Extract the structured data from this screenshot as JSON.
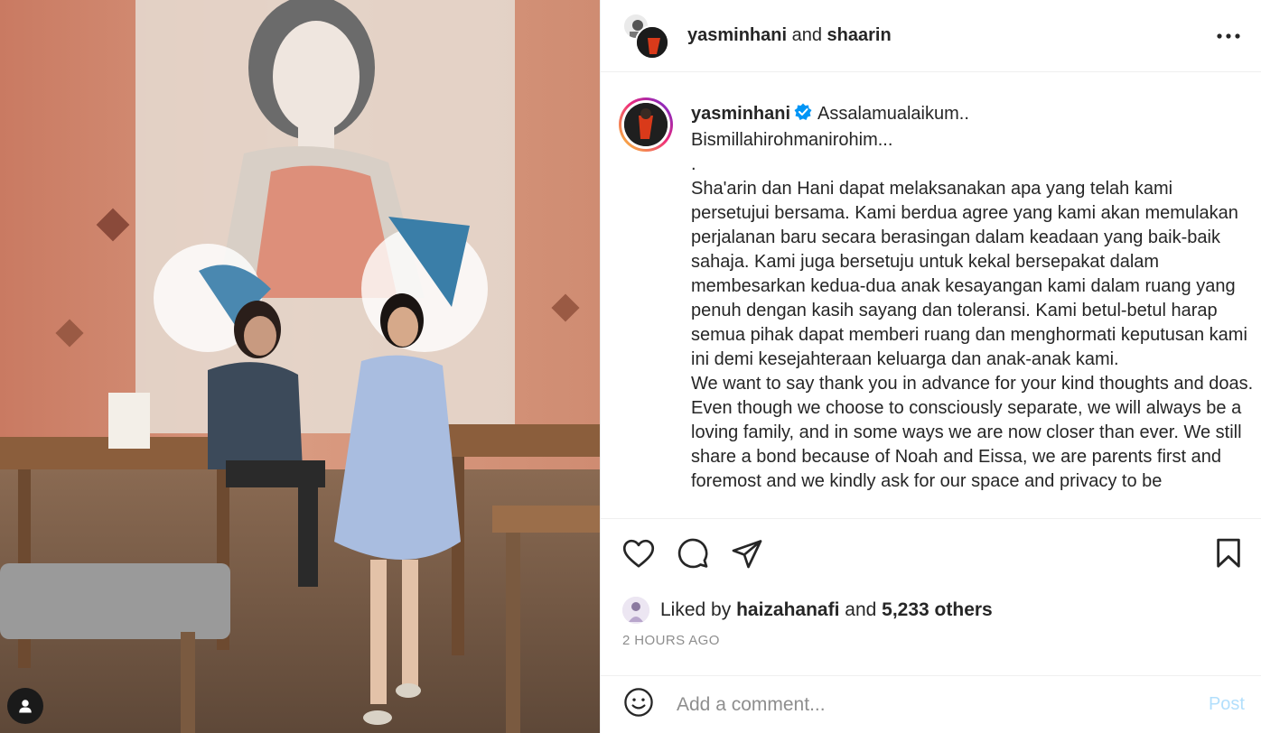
{
  "header": {
    "user1": "yasminhani",
    "conjunction": "and",
    "user2": "shaarin"
  },
  "caption": {
    "username": "yasminhani",
    "first_line": "Assalamualaikum..",
    "lines": [
      "Bismillahirohmanirohim...",
      ".",
      "Sha'arin dan Hani dapat melaksanakan apa yang telah kami persetujui bersama. Kami berdua agree yang kami akan memulakan perjalanan baru secara berasingan dalam keadaan yang baik-baik sahaja. Kami juga bersetuju untuk kekal bersepakat dalam membesarkan kedua-dua anak kesayangan kami dalam ruang yang penuh dengan kasih sayang dan toleransi. Kami betul-betul harap semua pihak dapat memberi ruang dan menghormati keputusan kami ini demi kesejahteraan keluarga dan anak-anak kami.",
      "We want to say thank you in advance for your kind thoughts and doas.",
      "Even though we choose to consciously separate, we will always be a loving family, and in some ways we are now closer than ever. We still share a bond because of Noah and Eissa, we are parents first and foremost and we kindly ask for our space and privacy to be"
    ]
  },
  "likes": {
    "prefix": "Liked by",
    "user": "haizahanafi",
    "conjunction": "and",
    "others": "5,233 others"
  },
  "time_ago": "2 HOURS AGO",
  "comment_box": {
    "placeholder": "Add a comment...",
    "post_label": "Post"
  },
  "colors": {
    "verified": "#0095f6",
    "post_disabled": "#b2dffc",
    "muted": "#8e8e8e"
  },
  "icons": {
    "more": "more-horizontal-icon",
    "like": "heart-icon",
    "comment": "comment-icon",
    "share": "paper-plane-icon",
    "save": "bookmark-icon",
    "emoji": "emoji-icon",
    "tags": "user-tag-icon"
  }
}
